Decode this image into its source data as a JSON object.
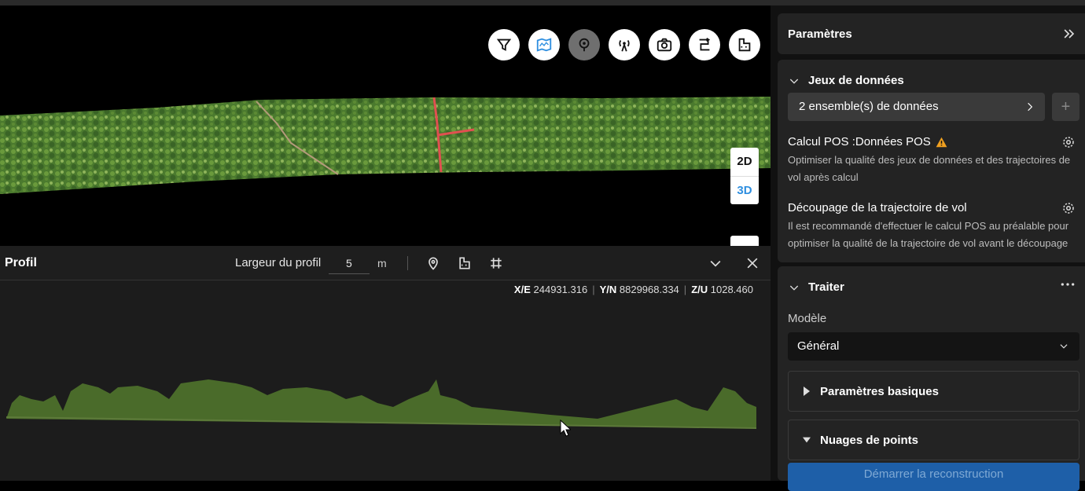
{
  "toolbar": {
    "icons": [
      "filter-icon",
      "map-layer-icon",
      "location-pin-icon",
      "antenna-icon",
      "camera-icon",
      "route-icon",
      "building-icon"
    ]
  },
  "view_toggle": {
    "mode_2d": "2D",
    "mode_3d": "3D",
    "selected": "3D"
  },
  "profile": {
    "title": "Profil",
    "width_label": "Largeur du profil",
    "width_value": "5",
    "width_unit": "m",
    "coords": {
      "xe_label": "X/E",
      "xe_value": "244931.316",
      "yn_label": "Y/N",
      "yn_value": "8829968.334",
      "zu_label": "Z/U",
      "zu_value": "1028.460"
    }
  },
  "sidebar": {
    "params_title": "Paramètres",
    "datasets": {
      "title": "Jeux de données",
      "count_label": "2 ensemble(s) de données",
      "pos_title": "Calcul POS :Données POS",
      "pos_desc": "Optimiser la qualité des jeux de données et des trajectoires de vol après calcul",
      "cut_title": "Découpage de la trajectoire de vol",
      "cut_desc": "Il est recommandé d'effectuer le calcul POS au préalable pour optimiser la qualité de la trajectoire de vol avant le découpage"
    },
    "process": {
      "title": "Traiter",
      "model_label": "Modèle",
      "model_value": "Général",
      "basic_params": "Paramètres basiques",
      "point_clouds": "Nuages de points",
      "start_button": "Démarrer la reconstruction"
    }
  },
  "colors": {
    "accent": "#2f8fe0",
    "warning": "#f0a020"
  }
}
